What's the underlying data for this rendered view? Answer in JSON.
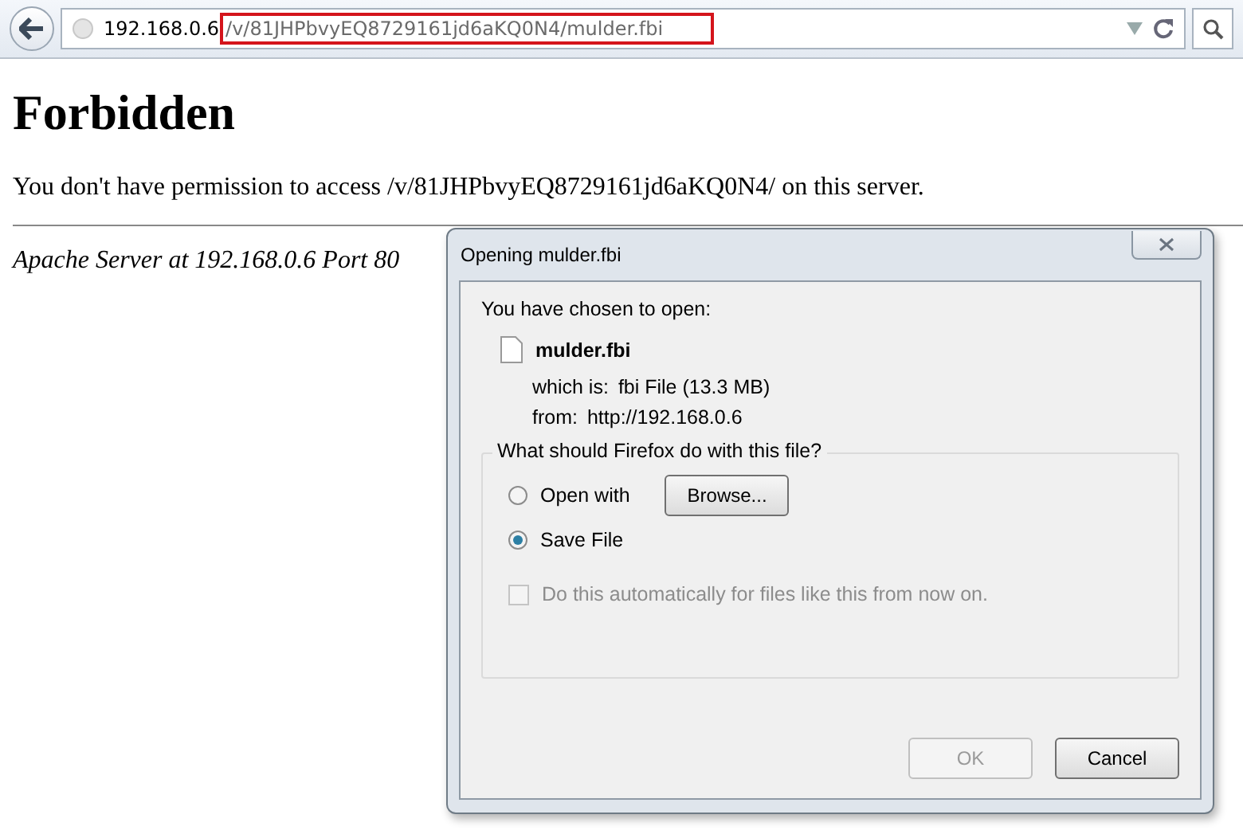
{
  "browser": {
    "url_host": "192.168.0.6",
    "url_path": "/v/81JHPbvyEQ8729161jd6aKQ0N4/mulder.fbi"
  },
  "page": {
    "heading": "Forbidden",
    "message": "You don't have permission to access /v/81JHPbvyEQ8729161jd6aKQ0N4/ on this server.",
    "address": "Apache Server at 192.168.0.6 Port 80"
  },
  "dialog": {
    "title": "Opening mulder.fbi",
    "intro": "You have chosen to open:",
    "file_name": "mulder.fbi",
    "details": [
      {
        "label": "which is:",
        "value": "fbi File (13.3 MB)"
      },
      {
        "label": "from:",
        "value": "http://192.168.0.6"
      }
    ],
    "group_label": "What should Firefox do with this file?",
    "options": [
      {
        "kind": "radio",
        "label": "Open with",
        "selected": false,
        "button": "Browse..."
      },
      {
        "kind": "radio",
        "label": "Save File",
        "selected": true
      },
      {
        "kind": "checkbox",
        "label": "Do this automatically for files like this from now on.",
        "checked": false,
        "disabled": true
      }
    ],
    "buttons": [
      {
        "label": "OK",
        "disabled": true
      },
      {
        "label": "Cancel",
        "disabled": false
      }
    ]
  }
}
